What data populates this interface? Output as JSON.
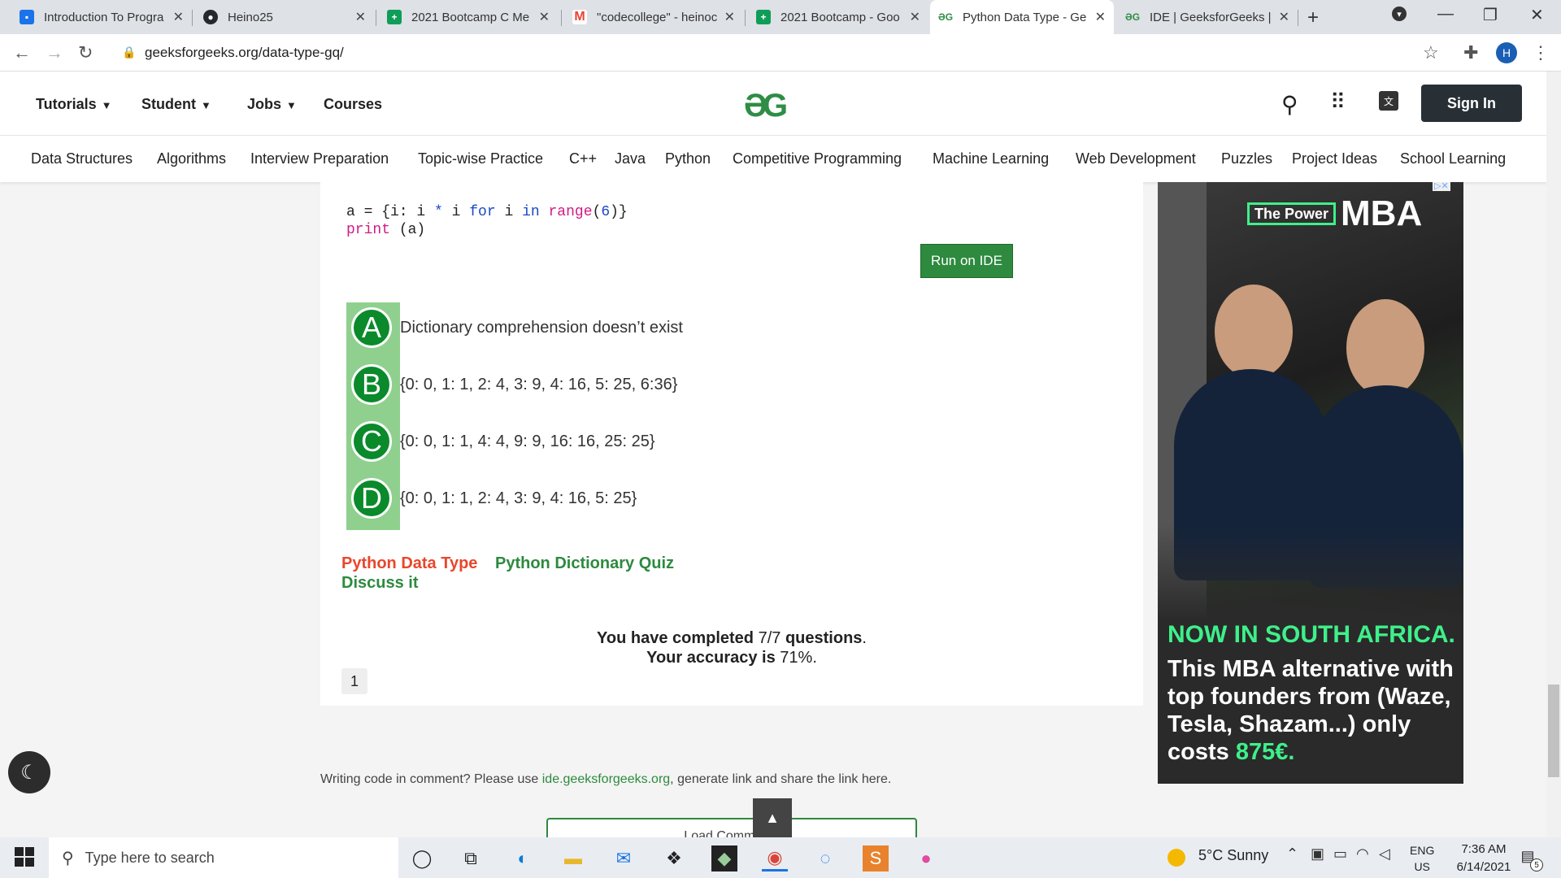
{
  "browser": {
    "tabs": [
      {
        "title": "Introduction To Progra",
        "favicon_color": "#1a73e8"
      },
      {
        "title": "Heino25",
        "favicon_color": "#24292e"
      },
      {
        "title": "2021 Bootcamp C Me",
        "favicon_color": "#0f9d58"
      },
      {
        "title": "\"codecollege\" - heinoc",
        "favicon_color": "#ea4335"
      },
      {
        "title": "2021 Bootcamp - Goo",
        "favicon_color": "#0f9d58"
      },
      {
        "title": "Python Data Type - Ge",
        "favicon_color": "#2f8d46"
      },
      {
        "title": "IDE | GeeksforGeeks |",
        "favicon_color": "#2f8d46"
      }
    ],
    "url": "geeksforgeeks.org/data-type-gq/",
    "profile_initial": "H"
  },
  "header": {
    "nav": [
      "Tutorials",
      "Student",
      "Jobs",
      "Courses"
    ],
    "logo": "ƏG",
    "signin": "Sign In",
    "subnav": [
      "Data Structures",
      "Algorithms",
      "Interview Preparation",
      "Topic-wise Practice",
      "C++",
      "Java",
      "Python",
      "Competitive Programming",
      "Machine Learning",
      "Web Development",
      "Puzzles",
      "Project Ideas",
      "School Learning"
    ]
  },
  "quiz": {
    "code_line1": {
      "a": "a = {i: i ",
      "star": "*",
      "b": " i ",
      "for": "for",
      "c": " i ",
      "in": "in",
      "d": " ",
      "range": "range",
      "e": "(",
      "num": "6",
      "f": ")}"
    },
    "code_line2": {
      "print": "print",
      "rest": " (a)"
    },
    "run_button": "Run on IDE",
    "options": [
      {
        "letter": "A",
        "text": "Dictionary comprehension doesn’t exist"
      },
      {
        "letter": "B",
        "text": "{0: 0, 1: 1, 2: 4, 3: 9, 4: 16, 5: 25, 6:36}"
      },
      {
        "letter": "C",
        "text": "{0: 0, 1: 1, 4: 4, 9: 9, 16: 16, 25: 25}"
      },
      {
        "letter": "D",
        "text": "{0: 0, 1: 1, 2: 4, 3: 9, 4: 16, 5: 25}"
      }
    ],
    "tag1": "Python Data Type",
    "tag2": "Python Dictionary Quiz",
    "discuss": "Discuss it",
    "completed_prefix": "You have completed ",
    "completed_value": "7/7",
    "completed_suffix": " questions",
    "accuracy_prefix": "Your accuracy is ",
    "accuracy_value": "71%",
    "page_number": "1"
  },
  "ad": {
    "logo_box": "The Power",
    "logo_mba": "MBA",
    "headline": "NOW IN SOUTH AFRICA.",
    "body": "This MBA alternative with top founders from (Waze, Tesla, Shazam...) only costs ",
    "price": "875€."
  },
  "footer": {
    "comment_prefix": "Writing code in comment? Please use ",
    "comment_link": "ide.geeksforgeeks.org",
    "comment_suffix": ", generate link and share the link here.",
    "load_comments": "Load Comments"
  },
  "taskbar": {
    "search_placeholder": "Type here to search",
    "weather": "5°C  Sunny",
    "lang_top": "ENG",
    "lang_bottom": "US",
    "time": "7:36 AM",
    "date": "6/14/2021",
    "notification_count": "5"
  },
  "colors": {
    "gfg_green": "#2f8d46",
    "ad_green": "#3ef08a",
    "option_green": "#0a8a2a",
    "tag_red": "#e8472b"
  }
}
